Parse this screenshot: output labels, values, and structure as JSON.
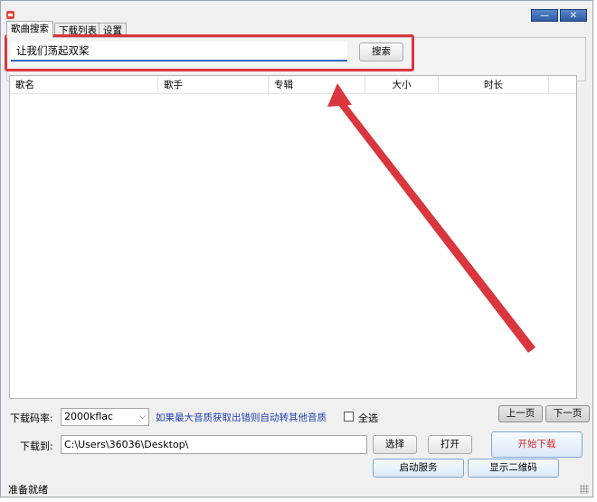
{
  "window": {
    "minimize_glyph": "—",
    "close_glyph": "✕"
  },
  "tabs": [
    {
      "label": "歌曲搜索",
      "active": true
    },
    {
      "label": "下载列表",
      "active": false
    },
    {
      "label": "设置",
      "active": false
    }
  ],
  "search": {
    "value": "让我们荡起双桨",
    "button_label": "搜索"
  },
  "table": {
    "columns": [
      "歌名",
      "歌手",
      "专辑",
      "大小",
      "时长"
    ],
    "rows": []
  },
  "pagination": {
    "prev_label": "上一页",
    "next_label": "下一页"
  },
  "bitrate": {
    "label": "下载码率:",
    "selected": "2000kflac",
    "hint": "如果最大音质获取出错则自动转其他音质",
    "select_all_label": "全选",
    "select_all_checked": false
  },
  "download": {
    "label": "下载到:",
    "path": "C:\\Users\\36036\\Desktop\\",
    "choose_label": "选择",
    "open_label": "打开",
    "start_label": "开始下载",
    "start_service_label": "启动服务",
    "qr_label": "显示二维码"
  },
  "status": {
    "text": "准备就绪"
  },
  "colors": {
    "annotation": "#d9363e",
    "hint_text": "#1f3fb0",
    "start_text": "#d22b2b",
    "accent_underline": "#2a66c0"
  }
}
